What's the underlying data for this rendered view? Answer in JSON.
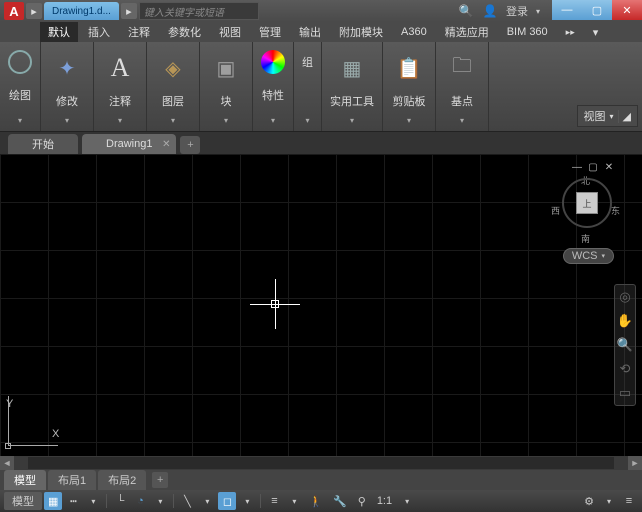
{
  "titlebar": {
    "logo": "A",
    "file_tab": "Drawing1.d...",
    "search_placeholder": "键入关键字或短语",
    "login_label": "登录",
    "help_label": "?"
  },
  "menubar": {
    "items": [
      "默认",
      "插入",
      "注释",
      "参数化",
      "视图",
      "管理",
      "输出",
      "附加模块",
      "A360",
      "精选应用",
      "BIM 360"
    ],
    "overflow": "▸▸",
    "more": "▾"
  },
  "ribbon": {
    "panels": [
      {
        "label": "绘图",
        "icon": "◯",
        "color": "#8aa"
      },
      {
        "label": "修改",
        "icon": "✕",
        "color": "#7c9fd9"
      },
      {
        "label": "注释",
        "icon": "A",
        "color": "#ddd"
      },
      {
        "label": "图层",
        "icon": "◈",
        "color": "#b89656"
      },
      {
        "label": "块",
        "icon": "▣",
        "color": "#9e9e9e"
      },
      {
        "label": "特性",
        "icon": "●",
        "color": ""
      },
      {
        "label": "组",
        "icon": "组",
        "color": "#ddd"
      },
      {
        "label": "实用工具",
        "icon": "▦",
        "color": "#9aa"
      },
      {
        "label": "剪贴板",
        "icon": "📋",
        "color": "#aaa"
      },
      {
        "label": "基点",
        "icon": "▬",
        "color": "#bbb"
      }
    ],
    "view_btn": "视图"
  },
  "doc_tabs": {
    "start": "开始",
    "drawing": "Drawing1"
  },
  "canvas": {
    "ucs_x": "X",
    "ucs_y": "Y",
    "viewcube_face": "上",
    "compass": {
      "n": "北",
      "s": "南",
      "e": "东",
      "w": "西"
    },
    "wcs": "WCS"
  },
  "layout_tabs": {
    "model": "模型",
    "layout1": "布局1",
    "layout2": "布局2"
  },
  "statusbar": {
    "model": "模型",
    "scale": "1:1"
  }
}
